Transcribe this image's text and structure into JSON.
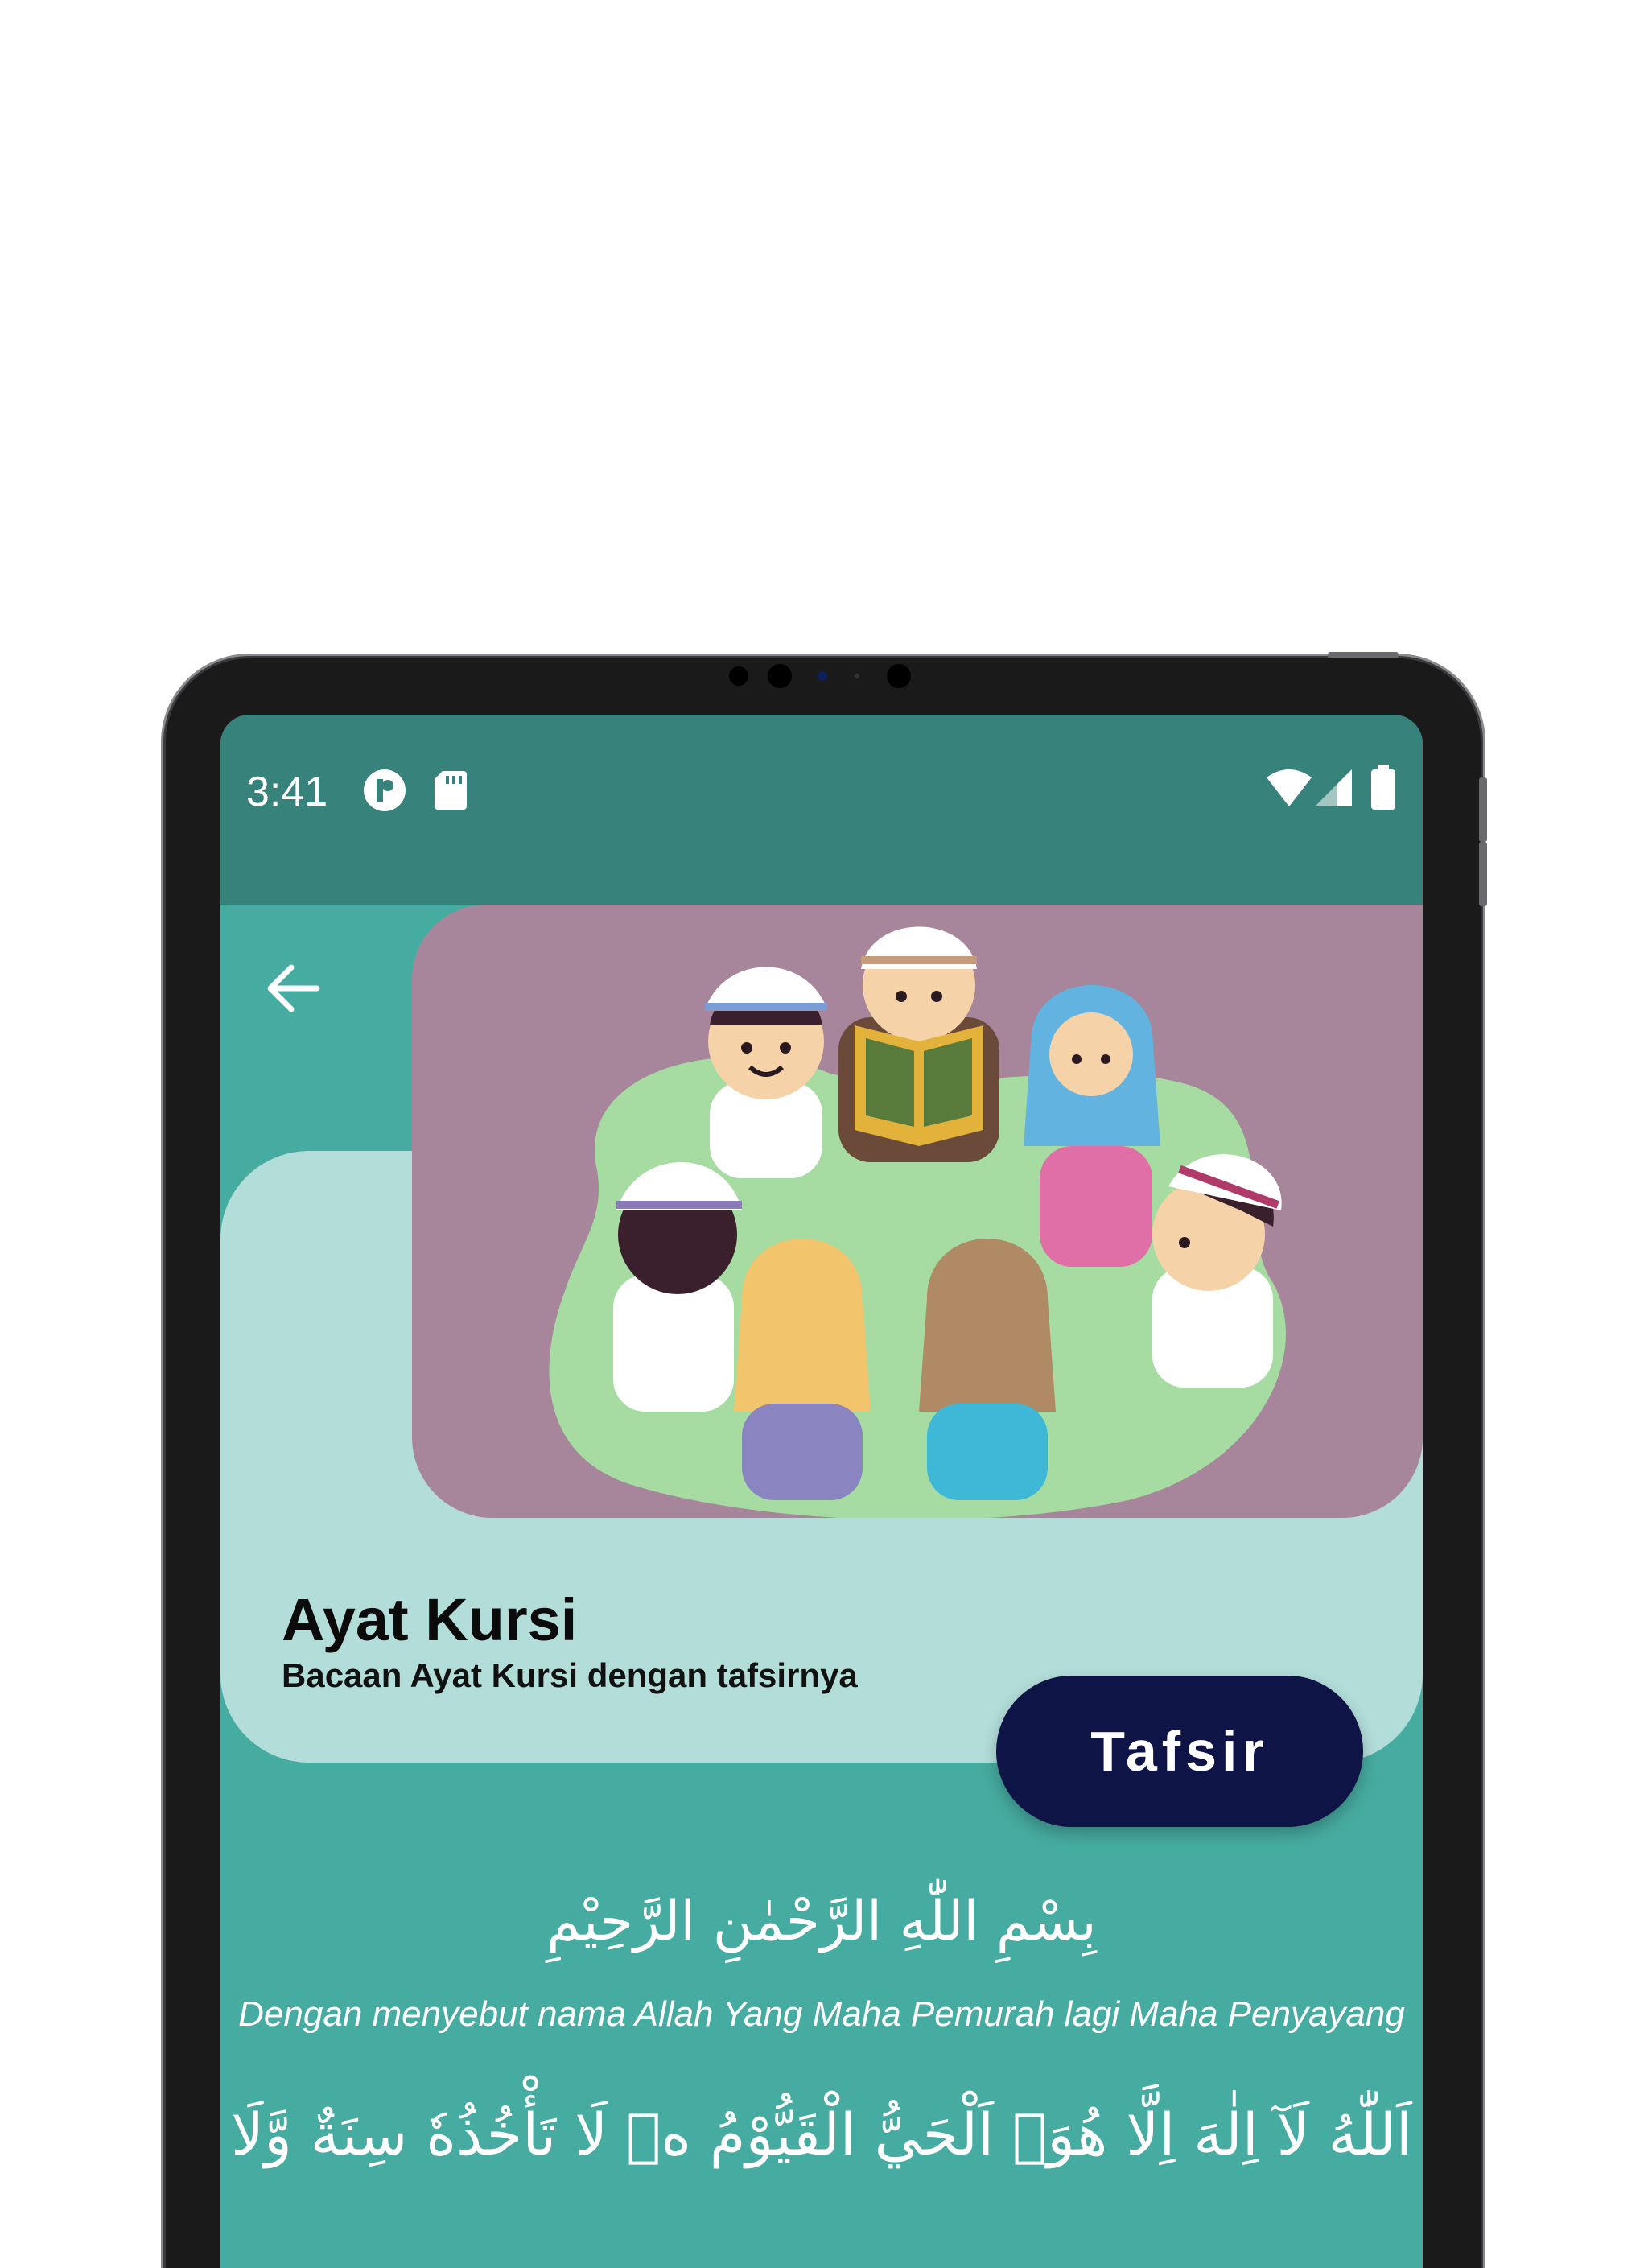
{
  "status_bar": {
    "time": "3:41"
  },
  "header": {
    "back_icon": "arrow-left-icon"
  },
  "content": {
    "title": "Ayat Kursi",
    "subtitle": "Bacaan Ayat Kursi dengan tafsirnya",
    "tafsir_button": "Tafsir",
    "basmala_arabic": "بِسْمِ اللّٰهِ الرَّحْمٰنِ الرَّحِيْمِ",
    "basmala_translation": "Dengan menyebut nama Allah Yang Maha Pemurah lagi Maha Penyayang",
    "verse_arabic": "اَللّٰهُ لَآ اِلٰهَ اِلَّا هُوَۚ اَلْحَيُّ الْقَيُّوْمُ ەۚ لَا تَأْخُذُهٗ سِنَةٌ وَّلَا"
  },
  "colors": {
    "status_bar": "#37827a",
    "background": "#46aba0",
    "card": "#b3ddd9",
    "illustration_bg": "#a7869c",
    "button": "#0f1447"
  }
}
